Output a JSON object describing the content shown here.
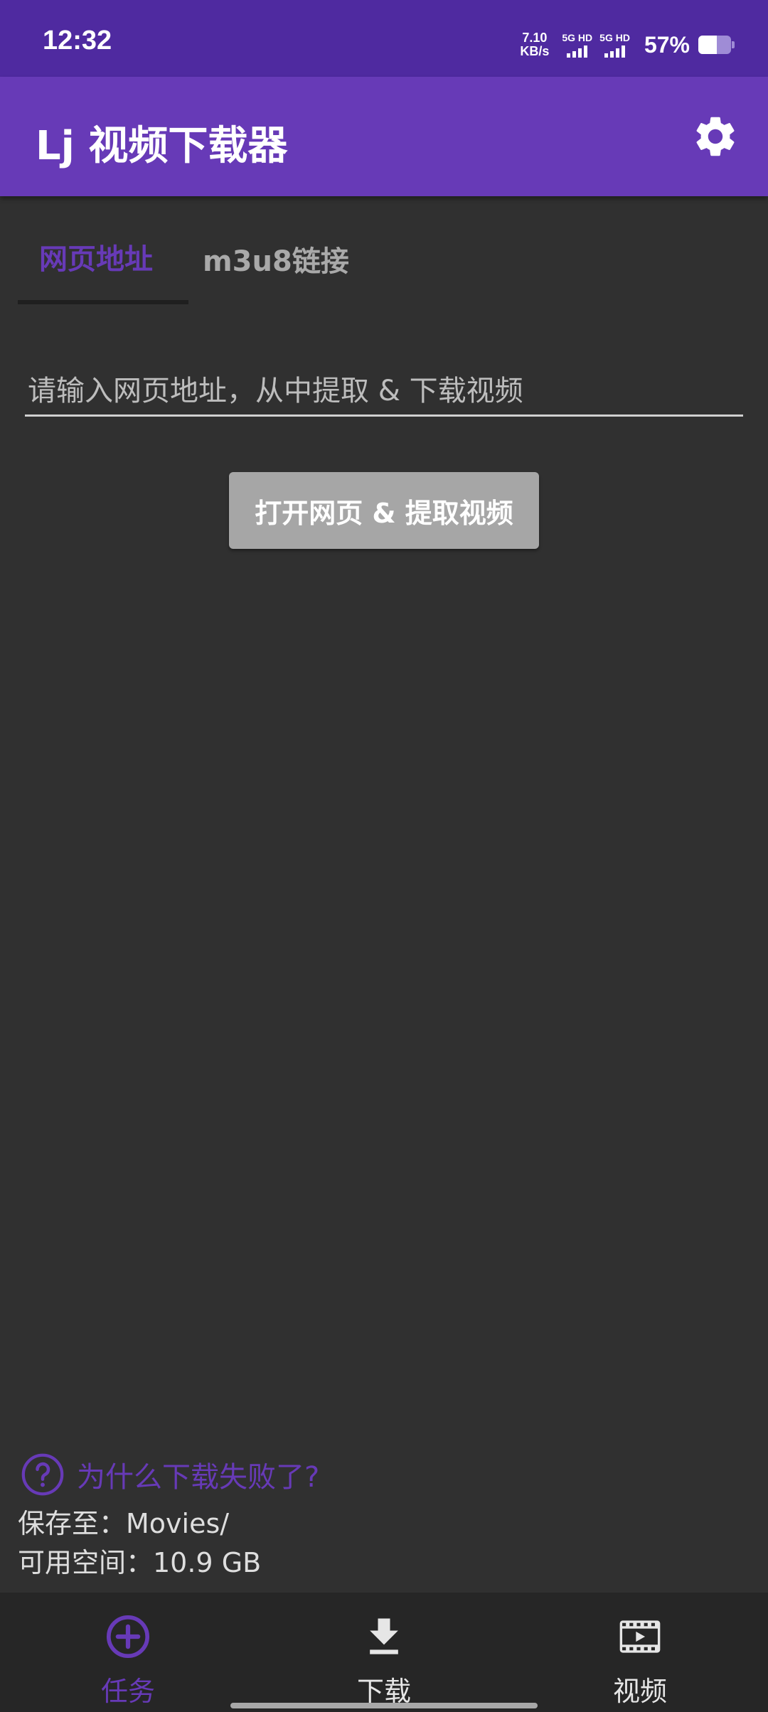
{
  "status_bar": {
    "time": "12:32",
    "net_speed_value": "7.10",
    "net_speed_unit": "KB/s",
    "sim1_label": "5G HD",
    "sim2_label": "5G HD",
    "battery_percent_text": "57%",
    "battery_level": 0.57
  },
  "app_bar": {
    "title": "Lj 视频下载器",
    "settings_icon": "gear-icon"
  },
  "tabs": [
    {
      "label": "网页地址",
      "active": true
    },
    {
      "label": "m3u8链接",
      "active": false
    }
  ],
  "url_input": {
    "placeholder": "请输入网页地址，从中提取 & 下载视频",
    "value": ""
  },
  "open_button": {
    "label": "打开网页 & 提取视频"
  },
  "info": {
    "help_text": "为什么下载失败了?",
    "help_icon": "help-circle-icon",
    "save_path": "保存至：Movies/",
    "free_space": "可用空间：10.9 GB"
  },
  "bottom_nav": [
    {
      "label": "任务",
      "icon": "add-circle-icon",
      "active": true
    },
    {
      "label": "下载",
      "icon": "download-icon",
      "active": false
    },
    {
      "label": "视频",
      "icon": "film-icon",
      "active": false
    }
  ],
  "colors": {
    "accent": "#673ab7",
    "status_bar": "#4f2aa0",
    "background": "#303030",
    "nav_background": "#262626",
    "button_background": "#a6a6a6"
  }
}
